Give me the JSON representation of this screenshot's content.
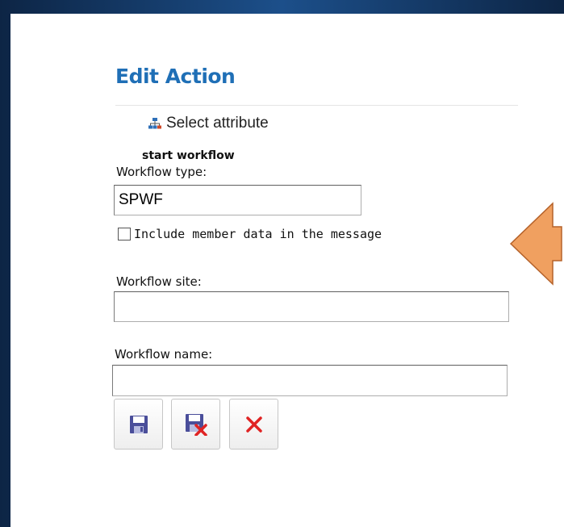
{
  "panel": {
    "title": "Edit Action",
    "select_attribute_label": "Select attribute",
    "section_title": "start workflow",
    "fields": {
      "workflow_type": {
        "label": "Workflow type:",
        "value": "SPWF"
      },
      "include_member_data": {
        "label": "Include member data in the message",
        "checked": false
      },
      "workflow_site": {
        "label": "Workflow site:",
        "value": ""
      },
      "workflow_name": {
        "label": "Workflow name:",
        "value": ""
      }
    },
    "buttons": {
      "save_icon": "save-icon",
      "save_close_icon": "save-and-close-icon",
      "cancel_icon": "delete-icon"
    }
  },
  "colors": {
    "title": "#1f6fb6",
    "arrow_fill": "#f0a060",
    "arrow_stroke": "#b5622a",
    "background": "#1c4f8a",
    "cancel_x": "#e02424"
  }
}
